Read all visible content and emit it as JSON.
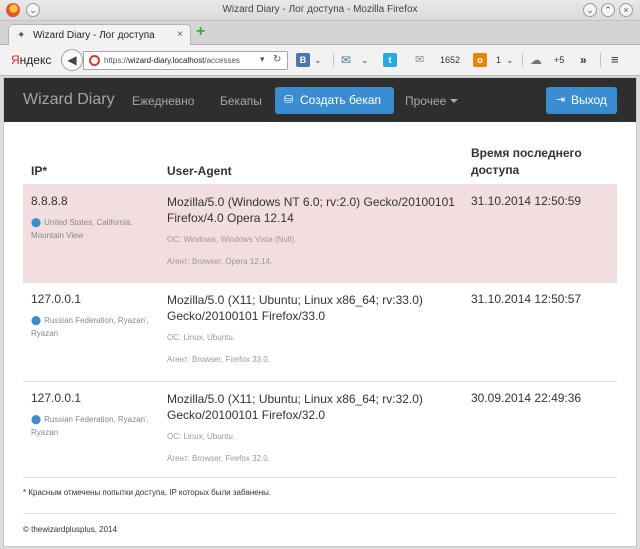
{
  "window": {
    "title": "Wizard Diary - Лог доступа - Mozilla Firefox"
  },
  "tab": {
    "title": "Wizard Diary - Лог доступа",
    "close_glyph": "×"
  },
  "newtab_glyph": "+",
  "toolbar": {
    "yandex_y": "Я",
    "yandex_rest": "ндекс",
    "url_scheme": "https://",
    "url_host": "wizard-diary.localhost",
    "url_path": "/accesses",
    "vk_label": "В",
    "mail_count": "1652",
    "ok_count": "1",
    "cloud_count": "+5",
    "more_glyph": "»",
    "menu_glyph": "≡"
  },
  "site": {
    "brand": "Wizard Diary",
    "nav": {
      "daily": "Ежедневно",
      "backups": "Бекапы",
      "create_backup": "Создать бекап",
      "other": "Прочее",
      "logout": "Выход"
    }
  },
  "table": {
    "headers": {
      "ip": "IP*",
      "user_agent": "User-Agent",
      "time": "Время последнего доступа"
    },
    "rows": [
      {
        "ip": "8.8.8.8",
        "location": "United States, California, Mountain View",
        "user_agent": "Mozilla/5.0 (Windows NT 6.0; rv:2.0) Gecko/20100101 Firefox/4.0 Opera 12.14",
        "os": "ОС: Windows, Windows Vista (Null).",
        "agent": "Агент: Browser, Opera 12.14.",
        "time": "31.10.2014 12:50:59",
        "banned": true
      },
      {
        "ip": "127.0.0.1",
        "location": "Russian Federation, Ryazan', Ryazan",
        "user_agent": "Mozilla/5.0 (X11; Ubuntu; Linux x86_64; rv:33.0) Gecko/20100101 Firefox/33.0",
        "os": "ОС: Linux, Ubuntu.",
        "agent": "Агент: Browser, Firefox 33.0.",
        "time": "31.10.2014 12:50:57",
        "banned": false
      },
      {
        "ip": "127.0.0.1",
        "location": "Russian Federation, Ryazan', Ryazan",
        "user_agent": "Mozilla/5.0 (X11; Ubuntu; Linux x86_64; rv:32.0) Gecko/20100101 Firefox/32.0",
        "os": "ОС: Linux, Ubuntu.",
        "agent": "Агент: Browser, Firefox 32.0.",
        "time": "30.09.2014 22:49:36",
        "banned": false
      }
    ]
  },
  "note": "* Красным отмечены попытки доступа, IP которых были забанены.",
  "footer": "© thewizardplusplus, 2014",
  "colors": {
    "navbar": "#2e2e2e",
    "primary_button": "#3a8dd0",
    "banned_row": "#f2dede"
  }
}
